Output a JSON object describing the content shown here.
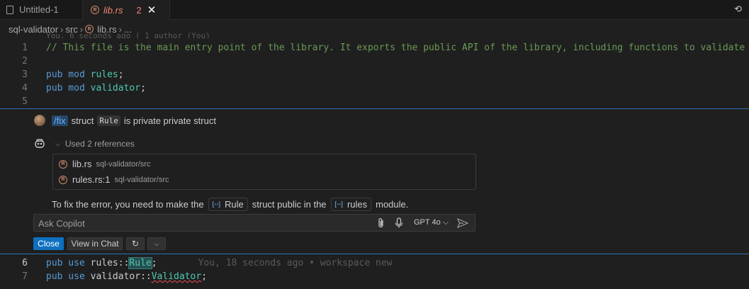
{
  "tabs": [
    {
      "label": "Untitled-1"
    },
    {
      "label": "lib.rs",
      "problems": "2",
      "close": "✕"
    }
  ],
  "history_icon": "⟲",
  "breadcrumb": [
    "sql-validator",
    "src",
    "lib.rs",
    "..."
  ],
  "ghost_blame": "You, 6 seconds ago | 1 author (You)",
  "code_top": [
    {
      "num": "1",
      "comment": "// This file is the main entry point of the library. It exports the public API of the library, including functions to validate SQ"
    },
    {
      "num": "2"
    },
    {
      "num": "3",
      "kw": "pub mod ",
      "name": "rules",
      "rest": ";"
    },
    {
      "num": "4",
      "kw": "pub mod ",
      "name": "validator",
      "rest": ";"
    },
    {
      "num": "5"
    }
  ],
  "chat": {
    "slash": "/fix",
    "req_pre": "struct",
    "req_code": "Rule",
    "req_post": "is private private struct",
    "refs_toggle": "Used 2 references",
    "refs": [
      {
        "name": "lib.rs",
        "path": "sql-validator/src"
      },
      {
        "name": "rules.rs:1",
        "path": "sql-validator/src"
      }
    ],
    "answer_1": "To fix the error, you need to make the",
    "answer_sym1": "Rule",
    "answer_2": "struct public in the",
    "answer_sym2": "rules",
    "answer_3": "module.",
    "ask_placeholder": "Ask Copilot",
    "model": "GPT 4o ⌵",
    "close_label": "Close",
    "view_label": "View in Chat",
    "redo_icon": "↻",
    "more_icon": "⌵"
  },
  "code_bottom": [
    {
      "num": "6",
      "kw": "pub use ",
      "mod": "rules",
      "sep": "::",
      "name": "Rule",
      "rest": ";",
      "blame": "You, 18 seconds ago • workspace new"
    },
    {
      "num": "7",
      "kw": "pub use ",
      "mod": "validator",
      "sep": "::",
      "name": "Validator",
      "rest": ";"
    }
  ],
  "colors": {
    "accent": "#0e70c0",
    "error": "#f48771",
    "comment": "#6a9955",
    "keyword": "#569cd6",
    "type": "#4ec9b0"
  }
}
